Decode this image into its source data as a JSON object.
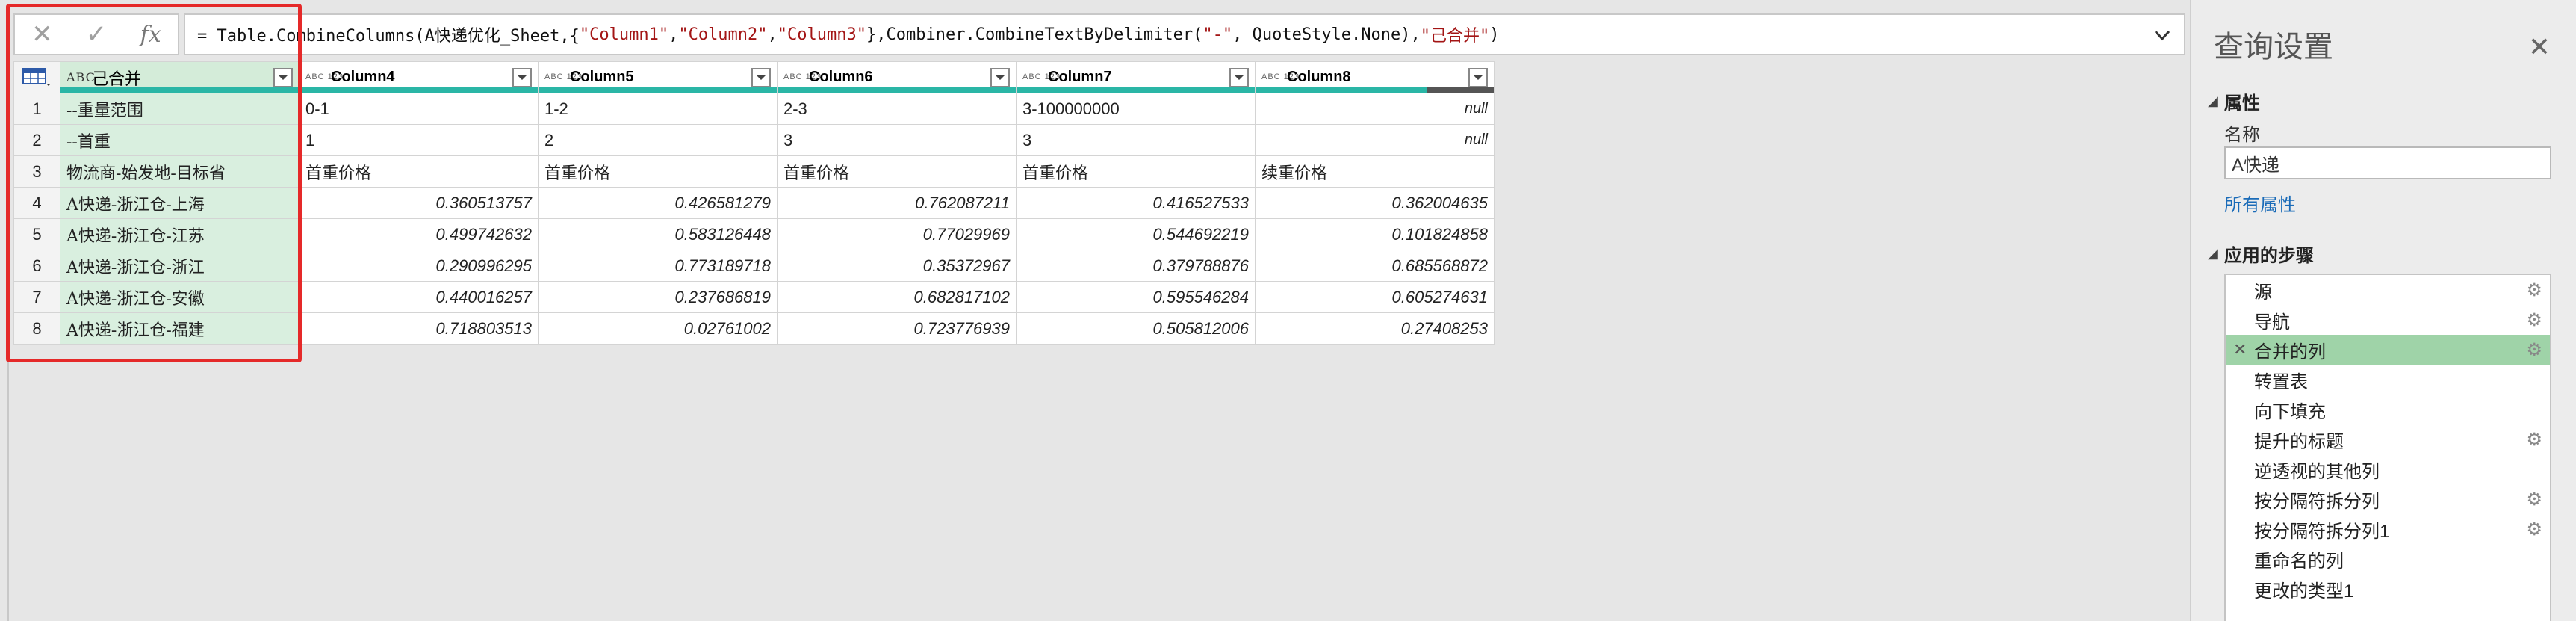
{
  "formula_bar": {
    "cancel_icon": "close-icon",
    "confirm_icon": "check-icon",
    "fx_label": "fx",
    "formula_prefix": "= Table.CombineColumns(A快递优化_Sheet,{",
    "formula_col1": "\"Column1\"",
    "formula_sep1": ", ",
    "formula_col2": "\"Column2\"",
    "formula_sep2": ", ",
    "formula_col3": "\"Column3\"",
    "formula_mid": "},Combiner.CombineTextByDelimiter(",
    "formula_delim": "\"-\"",
    "formula_mid2": ", QuoteStyle.None),",
    "formula_newname": "\"己合并\"",
    "formula_end": ")"
  },
  "grid": {
    "columns": [
      {
        "type": "ABC",
        "label": "己合并"
      },
      {
        "type": "ABC 123",
        "label": "Column4"
      },
      {
        "type": "ABC 123",
        "label": "Column5"
      },
      {
        "type": "ABC 123",
        "label": "Column6"
      },
      {
        "type": "ABC 123",
        "label": "Column7"
      },
      {
        "type": "ABC 123",
        "label": "Column8"
      }
    ],
    "rows": [
      {
        "n": "1",
        "c": [
          "--重量范围",
          "0-1",
          "1-2",
          "2-3",
          "3-100000000",
          "null"
        ]
      },
      {
        "n": "2",
        "c": [
          "--首重",
          "1",
          "2",
          "3",
          "3",
          "null"
        ]
      },
      {
        "n": "3",
        "c": [
          "物流商-始发地-目标省",
          "首重价格",
          "首重价格",
          "首重价格",
          "首重价格",
          "续重价格"
        ]
      },
      {
        "n": "4",
        "c": [
          "A快递-浙江仓-上海",
          "0.360513757",
          "0.426581279",
          "0.762087211",
          "0.416527533",
          "0.362004635"
        ]
      },
      {
        "n": "5",
        "c": [
          "A快递-浙江仓-江苏",
          "0.499742632",
          "0.583126448",
          "0.77029969",
          "0.544692219",
          "0.101824858"
        ]
      },
      {
        "n": "6",
        "c": [
          "A快递-浙江仓-浙江",
          "0.290996295",
          "0.773189718",
          "0.35372967",
          "0.379788876",
          "0.685568872"
        ]
      },
      {
        "n": "7",
        "c": [
          "A快递-浙江仓-安徽",
          "0.440016257",
          "0.237686819",
          "0.682817102",
          "0.595546284",
          "0.605274631"
        ]
      },
      {
        "n": "8",
        "c": [
          "A快递-浙江仓-福建",
          "0.718803513",
          "0.02761002",
          "0.723776939",
          "0.505812006",
          "0.27408253"
        ]
      }
    ]
  },
  "settings": {
    "title": "查询设置",
    "properties_header": "属性",
    "name_label": "名称",
    "name_value": "A快递",
    "all_properties_link": "所有属性",
    "steps_header": "应用的步骤",
    "steps": [
      {
        "label": "源",
        "gear": true,
        "active": false
      },
      {
        "label": "导航",
        "gear": true,
        "active": false
      },
      {
        "label": "合并的列",
        "gear": true,
        "active": true
      },
      {
        "label": "转置表",
        "gear": false,
        "active": false
      },
      {
        "label": "向下填充",
        "gear": false,
        "active": false
      },
      {
        "label": "提升的标题",
        "gear": true,
        "active": false
      },
      {
        "label": "逆透视的其他列",
        "gear": false,
        "active": false
      },
      {
        "label": "按分隔符拆分列",
        "gear": true,
        "active": false
      },
      {
        "label": "按分隔符拆分列1",
        "gear": true,
        "active": false
      },
      {
        "label": "重命名的列",
        "gear": false,
        "active": false
      },
      {
        "label": "更改的类型1",
        "gear": false,
        "active": false
      }
    ]
  },
  "colors": {
    "selected_column": "#d9efdf",
    "quality_bar": "#2ab6a6",
    "highlight_box": "#e52929",
    "active_step": "#9fd3a8",
    "link": "#1a6bb8"
  }
}
